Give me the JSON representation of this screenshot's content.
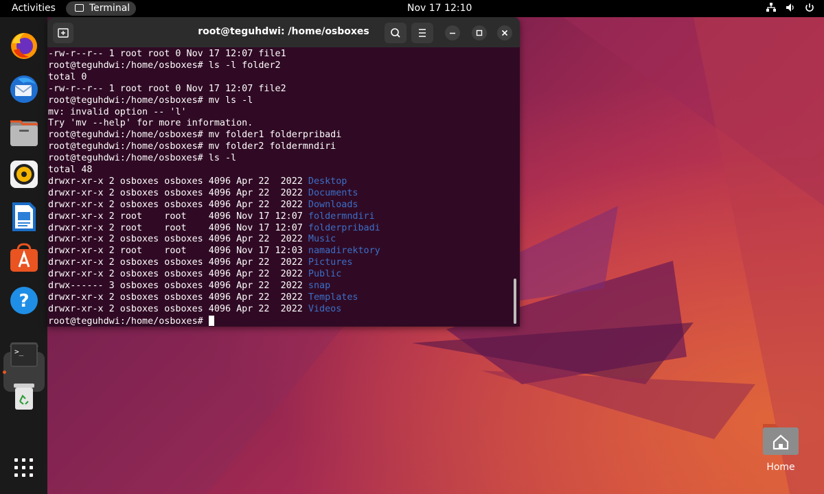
{
  "topbar": {
    "activities": "Activities",
    "app_name": "Terminal",
    "clock": "Nov 17  12:10"
  },
  "dock": {
    "items": [
      "firefox-icon",
      "thunderbird-icon",
      "files-icon",
      "rhythmbox-icon",
      "libreoffice-writer-icon",
      "app-center-icon",
      "help-icon",
      "terminal-icon",
      "trash-icon",
      "show-apps-icon"
    ]
  },
  "terminal": {
    "title": "root@teguhdwi: /home/osboxes",
    "prompt": "root@teguhdwi:/home/osboxes# ",
    "lines": [
      {
        "text": "-rw-r--r-- 1 root root 0 Nov 17 12:07 file1"
      },
      {
        "text": "root@teguhdwi:/home/osboxes# ls -l folder2"
      },
      {
        "text": "total 0"
      },
      {
        "text": "-rw-r--r-- 1 root root 0 Nov 17 12:07 file2"
      },
      {
        "text": "root@teguhdwi:/home/osboxes# mv ls -l"
      },
      {
        "text": "mv: invalid option -- 'l'"
      },
      {
        "text": "Try 'mv --help' for more information."
      },
      {
        "text": "root@teguhdwi:/home/osboxes# mv folder1 folderpribadi"
      },
      {
        "text": "root@teguhdwi:/home/osboxes# mv folder2 foldermndiri"
      },
      {
        "text": "root@teguhdwi:/home/osboxes# ls -l"
      },
      {
        "text": "total 48"
      },
      {
        "text": "drwxr-xr-x 2 osboxes osboxes 4096 Apr 22  2022 ",
        "dir": "Desktop"
      },
      {
        "text": "drwxr-xr-x 2 osboxes osboxes 4096 Apr 22  2022 ",
        "dir": "Documents"
      },
      {
        "text": "drwxr-xr-x 2 osboxes osboxes 4096 Apr 22  2022 ",
        "dir": "Downloads"
      },
      {
        "text": "drwxr-xr-x 2 root    root    4096 Nov 17 12:07 ",
        "dir": "foldermndiri"
      },
      {
        "text": "drwxr-xr-x 2 root    root    4096 Nov 17 12:07 ",
        "dir": "folderpribadi"
      },
      {
        "text": "drwxr-xr-x 2 osboxes osboxes 4096 Apr 22  2022 ",
        "dir": "Music"
      },
      {
        "text": "drwxr-xr-x 2 root    root    4096 Nov 17 12:03 ",
        "dir": "namadirektory"
      },
      {
        "text": "drwxr-xr-x 2 osboxes osboxes 4096 Apr 22  2022 ",
        "dir": "Pictures"
      },
      {
        "text": "drwxr-xr-x 2 osboxes osboxes 4096 Apr 22  2022 ",
        "dir": "Public"
      },
      {
        "text": "drwx------ 3 osboxes osboxes 4096 Apr 22  2022 ",
        "dir": "snap"
      },
      {
        "text": "drwxr-xr-x 2 osboxes osboxes 4096 Apr 22  2022 ",
        "dir": "Templates"
      },
      {
        "text": "drwxr-xr-x 2 osboxes osboxes 4096 Apr 22  2022 ",
        "dir": "Videos"
      }
    ],
    "directory_color": "#3b6fc9",
    "background_color": "#300a24"
  },
  "desktop": {
    "home_label": "Home"
  }
}
